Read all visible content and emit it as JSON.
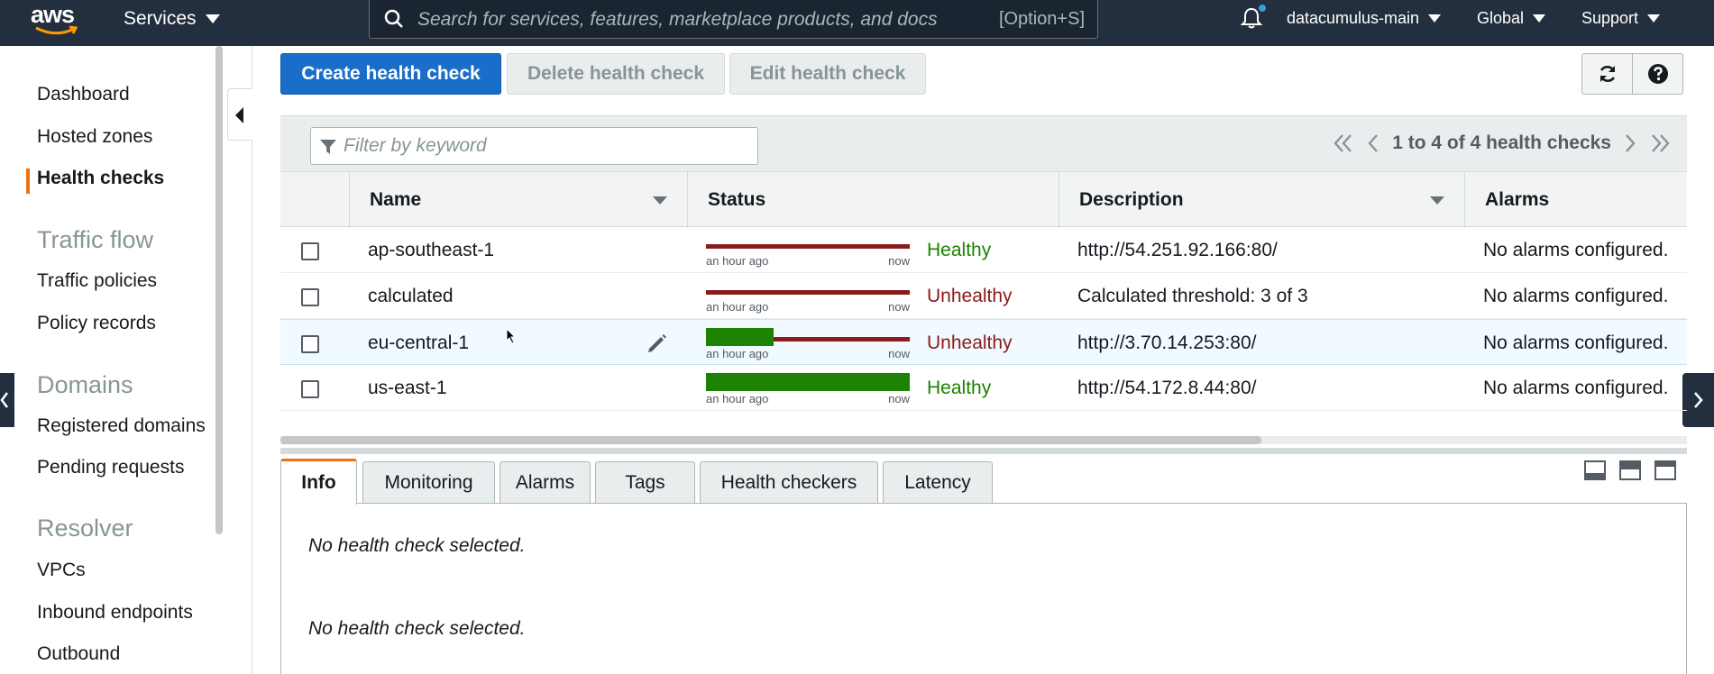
{
  "topnav": {
    "logo_text": "aws",
    "services_label": "Services",
    "search_placeholder": "Search for services, features, marketplace products, and docs",
    "search_shortcut": "[Option+S]",
    "account_label": "datacumulus-main",
    "region_label": "Global",
    "support_label": "Support"
  },
  "sidebar": {
    "items": [
      {
        "label": "Dashboard"
      },
      {
        "label": "Hosted zones"
      },
      {
        "label": "Health checks",
        "active": true
      }
    ],
    "sections": [
      {
        "title": "Traffic flow",
        "items": [
          {
            "label": "Traffic policies"
          },
          {
            "label": "Policy records"
          }
        ]
      },
      {
        "title": "Domains",
        "items": [
          {
            "label": "Registered domains"
          },
          {
            "label": "Pending requests"
          }
        ]
      },
      {
        "title": "Resolver",
        "items": [
          {
            "label": "VPCs"
          },
          {
            "label": "Inbound endpoints"
          },
          {
            "label": "Outbound"
          }
        ]
      }
    ]
  },
  "toolbar": {
    "create_label": "Create health check",
    "delete_label": "Delete health check",
    "edit_label": "Edit health check"
  },
  "table": {
    "filter_placeholder": "Filter by keyword",
    "pagination": "1 to 4 of 4 health checks",
    "columns": [
      "Name",
      "Status",
      "Description",
      "Alarms"
    ],
    "rows": [
      {
        "name": "ap-southeast-1",
        "status": "Healthy",
        "healthy_fraction": 0.0,
        "spark_start": "an hour ago",
        "spark_end": "now",
        "description": "http://54.251.92.166:80/",
        "alarms": "No alarms configured."
      },
      {
        "name": "calculated",
        "status": "Unhealthy",
        "healthy_fraction": 0.0,
        "spark_start": "an hour ago",
        "spark_end": "now",
        "description": "Calculated threshold: 3 of 3",
        "alarms": "No alarms configured."
      },
      {
        "name": "eu-central-1",
        "status": "Unhealthy",
        "healthy_fraction": 0.33,
        "spark_start": "an hour ago",
        "spark_end": "now",
        "description": "http://3.70.14.253:80/",
        "alarms": "No alarms configured."
      },
      {
        "name": "us-east-1",
        "status": "Healthy",
        "healthy_fraction": 1.0,
        "spark_start": "an hour ago",
        "spark_end": "now",
        "description": "http://54.172.8.44:80/",
        "alarms": "No alarms configured."
      }
    ]
  },
  "details": {
    "tabs": [
      "Info",
      "Monitoring",
      "Alarms",
      "Tags",
      "Health checkers",
      "Latency"
    ],
    "active_tab": "Info",
    "message_1": "No health check selected.",
    "message_2": "No health check selected."
  },
  "colors": {
    "nav_bg": "#232f3e",
    "primary": "#1a6ec9",
    "accent": "#ec7211",
    "healthy": "#1d8102",
    "unhealthy": "#8b1a1a"
  }
}
